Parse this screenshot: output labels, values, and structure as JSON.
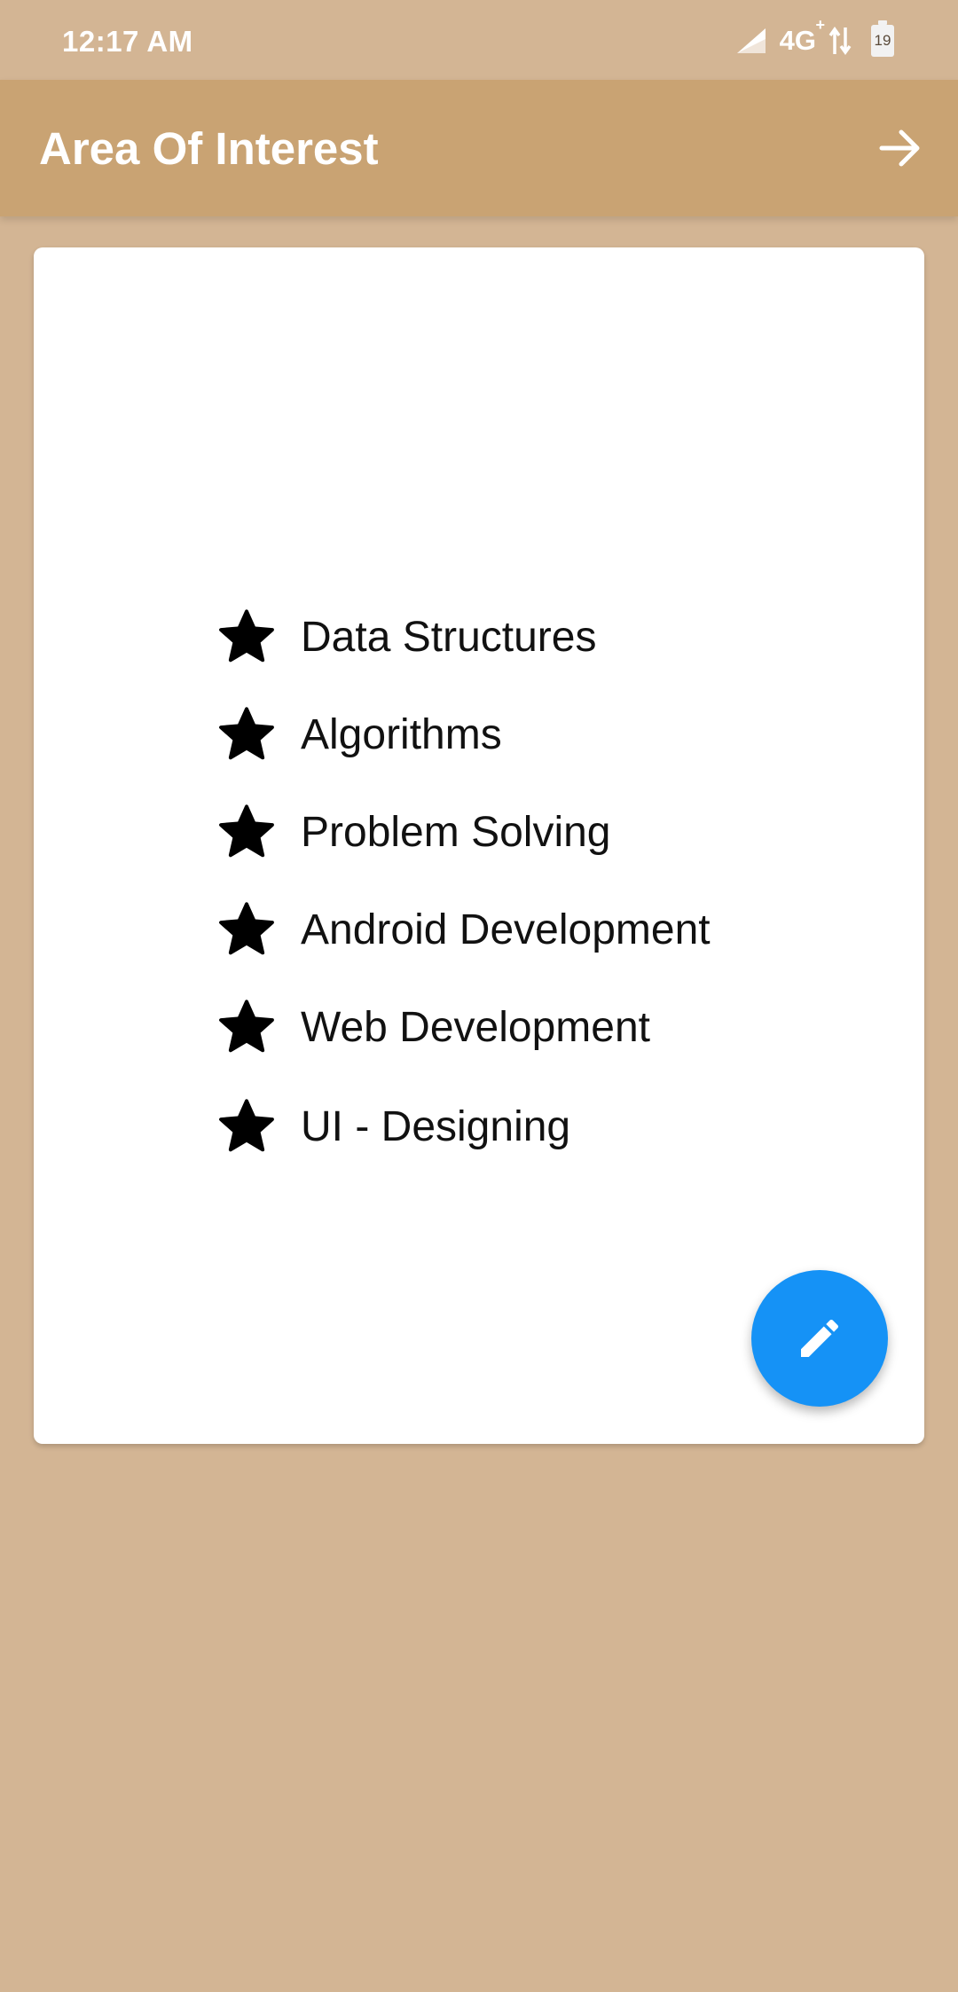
{
  "status_bar": {
    "time": "12:17 AM",
    "network": "4G",
    "network_sup": "+",
    "battery_level": "19",
    "icons": [
      "signal-icon",
      "data-transfer-icon",
      "battery-icon"
    ]
  },
  "app_bar": {
    "title": "Area Of Interest",
    "next_icon": "arrow-right-icon",
    "background_color": "#c9a373"
  },
  "card": {
    "interests": [
      {
        "label": "Data Structures",
        "icon": "star-icon"
      },
      {
        "label": "Algorithms",
        "icon": "star-icon"
      },
      {
        "label": "Problem Solving",
        "icon": "star-icon"
      },
      {
        "label": "Android Development",
        "icon": "star-icon"
      },
      {
        "label": "Web Development",
        "icon": "star-icon"
      },
      {
        "label": "UI - Designing",
        "icon": "star-icon"
      }
    ]
  },
  "fab": {
    "icon": "pencil-icon",
    "color": "#1592f6"
  },
  "colors": {
    "page_background": "#d3b594",
    "card_background": "#ffffff"
  }
}
